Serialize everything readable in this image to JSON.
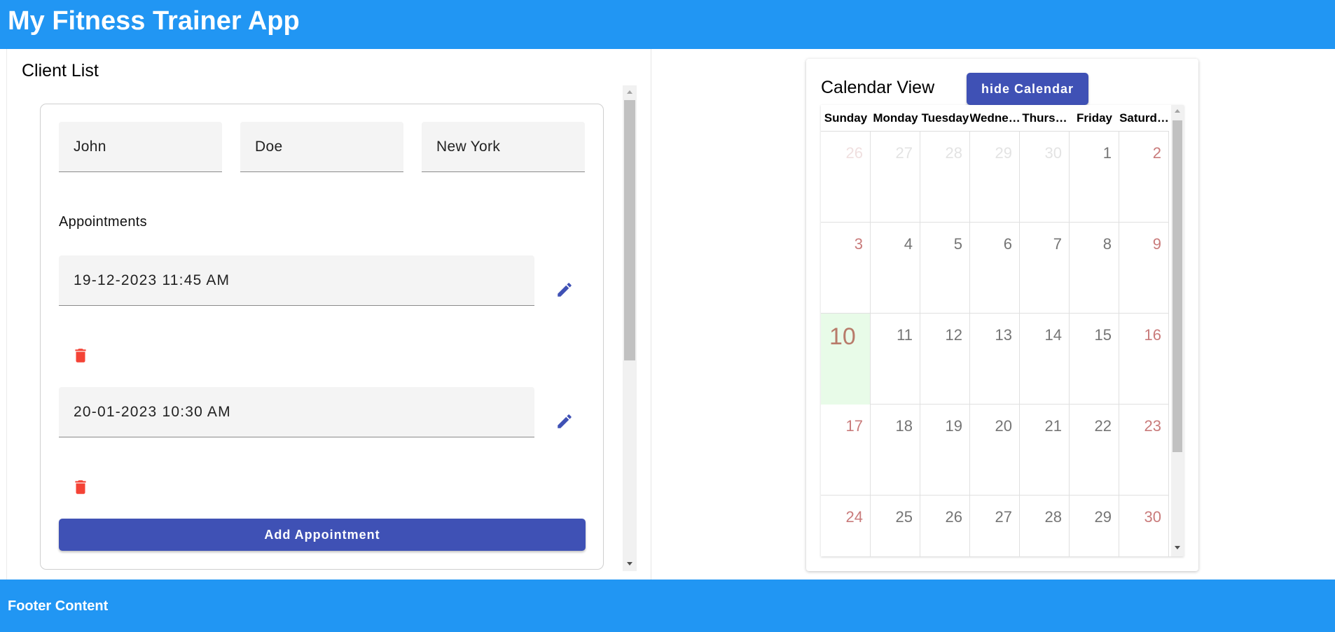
{
  "header": {
    "title": "My Fitness Trainer App"
  },
  "client_list": {
    "title": "Client List",
    "client": {
      "first_name": "John",
      "last_name": "Doe",
      "city": "New York"
    },
    "appointments_label": "Appointments",
    "appointments": [
      {
        "datetime": "19-12-2023 11:45 AM",
        "edit_icon": "pencil-icon",
        "delete_icon": "trash-icon"
      },
      {
        "datetime": "20-01-2023 10:30 AM",
        "edit_icon": "pencil-icon",
        "delete_icon": "trash-icon"
      }
    ],
    "add_button_label": "Add Appointment"
  },
  "calendar": {
    "title": "Calendar View",
    "toggle_button_label": "hide Calendar",
    "weekdays": [
      "Sunday",
      "Monday",
      "Tuesday",
      "Wedne…",
      "Thurs…",
      "Friday",
      "Saturd…"
    ],
    "weeks": [
      [
        {
          "d": "26",
          "other": true
        },
        {
          "d": "27",
          "other": true
        },
        {
          "d": "28",
          "other": true
        },
        {
          "d": "29",
          "other": true
        },
        {
          "d": "30",
          "other": true
        },
        {
          "d": "1"
        },
        {
          "d": "2"
        }
      ],
      [
        {
          "d": "3"
        },
        {
          "d": "4"
        },
        {
          "d": "5"
        },
        {
          "d": "6"
        },
        {
          "d": "7"
        },
        {
          "d": "8"
        },
        {
          "d": "9"
        }
      ],
      [
        {
          "d": "10",
          "today": true
        },
        {
          "d": "11"
        },
        {
          "d": "12"
        },
        {
          "d": "13"
        },
        {
          "d": "14"
        },
        {
          "d": "15"
        },
        {
          "d": "16"
        }
      ],
      [
        {
          "d": "17"
        },
        {
          "d": "18"
        },
        {
          "d": "19"
        },
        {
          "d": "20"
        },
        {
          "d": "21"
        },
        {
          "d": "22"
        },
        {
          "d": "23"
        }
      ],
      [
        {
          "d": "24"
        },
        {
          "d": "25"
        },
        {
          "d": "26"
        },
        {
          "d": "27"
        },
        {
          "d": "28"
        },
        {
          "d": "29"
        },
        {
          "d": "30"
        }
      ]
    ]
  },
  "footer": {
    "text": "Footer Content"
  },
  "colors": {
    "primary": "#2196f3",
    "button": "#3f51b5",
    "delete": "#f44336",
    "today_bg": "#e8fbe8"
  }
}
